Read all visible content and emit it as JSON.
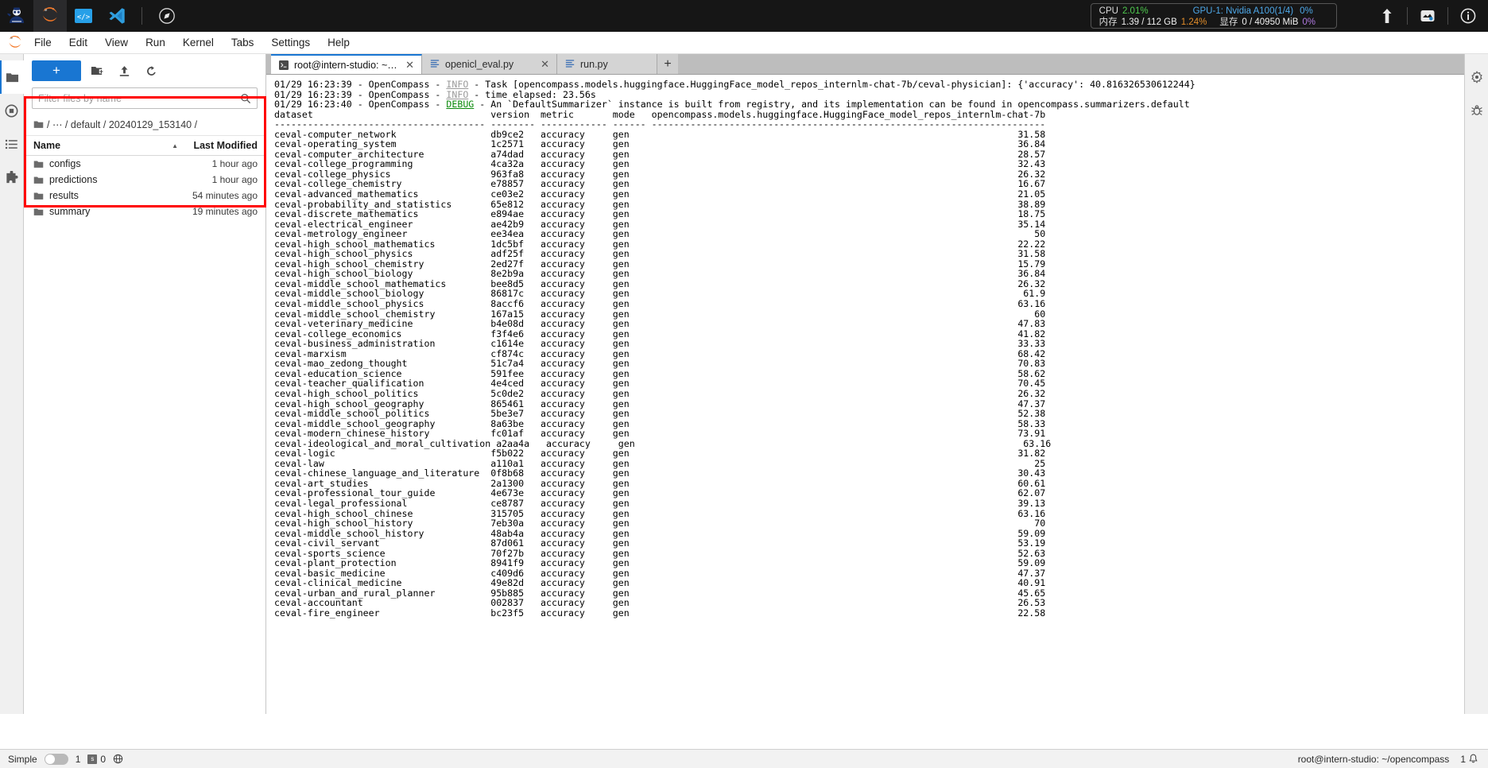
{
  "os_bar": {
    "apps": [
      {
        "name": "intern-studio-logo-icon",
        "active": false
      },
      {
        "name": "jupyterlab-icon",
        "active": true
      },
      {
        "name": "vscode-web-icon",
        "active": false
      },
      {
        "name": "vscode-icon",
        "active": false
      }
    ],
    "compass_icon": "compass-icon",
    "stats": {
      "cpu_label": "CPU",
      "cpu_value": "2.01%",
      "mem_label": "内存",
      "mem_value": "1.39 / 112 GB",
      "mem_percent": "1.24%",
      "gpu_label": "GPU-1: Nvidia A100(1/4)",
      "gpu_percent": "0%",
      "vram_label": "显存",
      "vram_value": "0 / 40950 MiB",
      "vram_percent": "0%"
    },
    "right_icons": [
      "upload-arrow-icon",
      "server-status-icon",
      "info-circle-icon"
    ]
  },
  "menu": {
    "logo_icon": "jupyter-logo-icon",
    "items": [
      "File",
      "Edit",
      "View",
      "Run",
      "Kernel",
      "Tabs",
      "Settings",
      "Help"
    ]
  },
  "left_rail": {
    "items": [
      {
        "name": "file-browser-icon",
        "label": "File Browser",
        "active": true
      },
      {
        "name": "running-terminals-icon",
        "label": "Running Terminals and Kernels",
        "active": false
      },
      {
        "name": "table-of-contents-icon",
        "label": "Table of Contents",
        "active": false
      },
      {
        "name": "extension-manager-icon",
        "label": "Extension Manager",
        "active": false
      }
    ]
  },
  "right_rail": {
    "items": [
      {
        "name": "property-inspector-icon",
        "label": "Property Inspector"
      },
      {
        "name": "debugger-icon",
        "label": "Debugger"
      }
    ]
  },
  "file_browser": {
    "new_launcher_label": "+",
    "toolbar_icons": [
      "new-folder-icon",
      "upload-icon",
      "refresh-icon"
    ],
    "filter_placeholder": "Filter files by name",
    "filter_value": "",
    "search_icon": "search-icon",
    "breadcrumb": {
      "root_icon": "folder-icon",
      "parts": [
        "/",
        "…",
        "/",
        "default",
        "/",
        "20240129_153140",
        "/"
      ],
      "text": "/ ⋯ / default / 20240129_153140 /"
    },
    "columns": {
      "name": "Name",
      "last_modified": "Last Modified"
    },
    "sort_caret": "▲",
    "rows": [
      {
        "name": "configs",
        "modified": "1 hour ago",
        "icon": "folder-icon"
      },
      {
        "name": "predictions",
        "modified": "1 hour ago",
        "icon": "folder-icon"
      },
      {
        "name": "results",
        "modified": "54 minutes ago",
        "icon": "folder-icon"
      },
      {
        "name": "summary",
        "modified": "19 minutes ago",
        "icon": "folder-icon"
      }
    ],
    "highlight_color": "#ff0000"
  },
  "dock": {
    "tabs": [
      {
        "label": "root@intern-studio: ~/ope",
        "icon": "terminal-icon",
        "active": true,
        "closable": true
      },
      {
        "label": "openicl_eval.py",
        "icon": "text-file-icon",
        "active": false,
        "closable": true
      },
      {
        "label": "run.py",
        "icon": "text-file-icon",
        "active": false,
        "closable": true
      }
    ],
    "add_tab_label": "+"
  },
  "terminal": {
    "log_lines": [
      {
        "ts": "01/29 16:23:39",
        "app": "OpenCompass",
        "level": "INFO",
        "level_class": "lg",
        "msg": "Task [opencompass.models.huggingface.HuggingFace_model_repos_internlm-chat-7b/ceval-physician]: {'accuracy': 40.816326530612244}"
      },
      {
        "ts": "01/29 16:23:39",
        "app": "OpenCompass",
        "level": "INFO",
        "level_class": "lg",
        "msg": "time elapsed: 23.56s"
      },
      {
        "ts": "01/29 16:23:40",
        "app": "OpenCompass",
        "level": "DEBUG",
        "level_class": "dg",
        "msg": "An `DefaultSummarizer` instance is built from registry, and its implementation can be found in opencompass.summarizers.default"
      }
    ],
    "table": {
      "headers": [
        "dataset",
        "version",
        "metric",
        "mode",
        "opencompass.models.huggingface.HuggingFace_model_repos_internlm-chat-7b"
      ],
      "rule": "-",
      "rows": [
        {
          "dataset": "ceval-computer_network",
          "version": "db9ce2",
          "metric": "accuracy",
          "mode": "gen",
          "score": "31.58"
        },
        {
          "dataset": "ceval-operating_system",
          "version": "1c2571",
          "metric": "accuracy",
          "mode": "gen",
          "score": "36.84"
        },
        {
          "dataset": "ceval-computer_architecture",
          "version": "a74dad",
          "metric": "accuracy",
          "mode": "gen",
          "score": "28.57"
        },
        {
          "dataset": "ceval-college_programming",
          "version": "4ca32a",
          "metric": "accuracy",
          "mode": "gen",
          "score": "32.43"
        },
        {
          "dataset": "ceval-college_physics",
          "version": "963fa8",
          "metric": "accuracy",
          "mode": "gen",
          "score": "26.32"
        },
        {
          "dataset": "ceval-college_chemistry",
          "version": "e78857",
          "metric": "accuracy",
          "mode": "gen",
          "score": "16.67"
        },
        {
          "dataset": "ceval-advanced_mathematics",
          "version": "ce03e2",
          "metric": "accuracy",
          "mode": "gen",
          "score": "21.05"
        },
        {
          "dataset": "ceval-probability_and_statistics",
          "version": "65e812",
          "metric": "accuracy",
          "mode": "gen",
          "score": "38.89"
        },
        {
          "dataset": "ceval-discrete_mathematics",
          "version": "e894ae",
          "metric": "accuracy",
          "mode": "gen",
          "score": "18.75"
        },
        {
          "dataset": "ceval-electrical_engineer",
          "version": "ae42b9",
          "metric": "accuracy",
          "mode": "gen",
          "score": "35.14"
        },
        {
          "dataset": "ceval-metrology_engineer",
          "version": "ee34ea",
          "metric": "accuracy",
          "mode": "gen",
          "score": "50"
        },
        {
          "dataset": "ceval-high_school_mathematics",
          "version": "1dc5bf",
          "metric": "accuracy",
          "mode": "gen",
          "score": "22.22"
        },
        {
          "dataset": "ceval-high_school_physics",
          "version": "adf25f",
          "metric": "accuracy",
          "mode": "gen",
          "score": "31.58"
        },
        {
          "dataset": "ceval-high_school_chemistry",
          "version": "2ed27f",
          "metric": "accuracy",
          "mode": "gen",
          "score": "15.79"
        },
        {
          "dataset": "ceval-high_school_biology",
          "version": "8e2b9a",
          "metric": "accuracy",
          "mode": "gen",
          "score": "36.84"
        },
        {
          "dataset": "ceval-middle_school_mathematics",
          "version": "bee8d5",
          "metric": "accuracy",
          "mode": "gen",
          "score": "26.32"
        },
        {
          "dataset": "ceval-middle_school_biology",
          "version": "86817c",
          "metric": "accuracy",
          "mode": "gen",
          "score": "61.9"
        },
        {
          "dataset": "ceval-middle_school_physics",
          "version": "8accf6",
          "metric": "accuracy",
          "mode": "gen",
          "score": "63.16"
        },
        {
          "dataset": "ceval-middle_school_chemistry",
          "version": "167a15",
          "metric": "accuracy",
          "mode": "gen",
          "score": "60"
        },
        {
          "dataset": "ceval-veterinary_medicine",
          "version": "b4e08d",
          "metric": "accuracy",
          "mode": "gen",
          "score": "47.83"
        },
        {
          "dataset": "ceval-college_economics",
          "version": "f3f4e6",
          "metric": "accuracy",
          "mode": "gen",
          "score": "41.82"
        },
        {
          "dataset": "ceval-business_administration",
          "version": "c1614e",
          "metric": "accuracy",
          "mode": "gen",
          "score": "33.33"
        },
        {
          "dataset": "ceval-marxism",
          "version": "cf874c",
          "metric": "accuracy",
          "mode": "gen",
          "score": "68.42"
        },
        {
          "dataset": "ceval-mao_zedong_thought",
          "version": "51c7a4",
          "metric": "accuracy",
          "mode": "gen",
          "score": "70.83"
        },
        {
          "dataset": "ceval-education_science",
          "version": "591fee",
          "metric": "accuracy",
          "mode": "gen",
          "score": "58.62"
        },
        {
          "dataset": "ceval-teacher_qualification",
          "version": "4e4ced",
          "metric": "accuracy",
          "mode": "gen",
          "score": "70.45"
        },
        {
          "dataset": "ceval-high_school_politics",
          "version": "5c0de2",
          "metric": "accuracy",
          "mode": "gen",
          "score": "26.32"
        },
        {
          "dataset": "ceval-high_school_geography",
          "version": "865461",
          "metric": "accuracy",
          "mode": "gen",
          "score": "47.37"
        },
        {
          "dataset": "ceval-middle_school_politics",
          "version": "5be3e7",
          "metric": "accuracy",
          "mode": "gen",
          "score": "52.38"
        },
        {
          "dataset": "ceval-middle_school_geography",
          "version": "8a63be",
          "metric": "accuracy",
          "mode": "gen",
          "score": "58.33"
        },
        {
          "dataset": "ceval-modern_chinese_history",
          "version": "fc01af",
          "metric": "accuracy",
          "mode": "gen",
          "score": "73.91"
        },
        {
          "dataset": "ceval-ideological_and_moral_cultivation",
          "version": "a2aa4a",
          "metric": "accuracy",
          "mode": "gen",
          "score": "63.16"
        },
        {
          "dataset": "ceval-logic",
          "version": "f5b022",
          "metric": "accuracy",
          "mode": "gen",
          "score": "31.82"
        },
        {
          "dataset": "ceval-law",
          "version": "a110a1",
          "metric": "accuracy",
          "mode": "gen",
          "score": "25"
        },
        {
          "dataset": "ceval-chinese_language_and_literature",
          "version": "0f8b68",
          "metric": "accuracy",
          "mode": "gen",
          "score": "30.43"
        },
        {
          "dataset": "ceval-art_studies",
          "version": "2a1300",
          "metric": "accuracy",
          "mode": "gen",
          "score": "60.61"
        },
        {
          "dataset": "ceval-professional_tour_guide",
          "version": "4e673e",
          "metric": "accuracy",
          "mode": "gen",
          "score": "62.07"
        },
        {
          "dataset": "ceval-legal_professional",
          "version": "ce8787",
          "metric": "accuracy",
          "mode": "gen",
          "score": "39.13"
        },
        {
          "dataset": "ceval-high_school_chinese",
          "version": "315705",
          "metric": "accuracy",
          "mode": "gen",
          "score": "63.16"
        },
        {
          "dataset": "ceval-high_school_history",
          "version": "7eb30a",
          "metric": "accuracy",
          "mode": "gen",
          "score": "70"
        },
        {
          "dataset": "ceval-middle_school_history",
          "version": "48ab4a",
          "metric": "accuracy",
          "mode": "gen",
          "score": "59.09"
        },
        {
          "dataset": "ceval-civil_servant",
          "version": "87d061",
          "metric": "accuracy",
          "mode": "gen",
          "score": "53.19"
        },
        {
          "dataset": "ceval-sports_science",
          "version": "70f27b",
          "metric": "accuracy",
          "mode": "gen",
          "score": "52.63"
        },
        {
          "dataset": "ceval-plant_protection",
          "version": "8941f9",
          "metric": "accuracy",
          "mode": "gen",
          "score": "59.09"
        },
        {
          "dataset": "ceval-basic_medicine",
          "version": "c409d6",
          "metric": "accuracy",
          "mode": "gen",
          "score": "47.37"
        },
        {
          "dataset": "ceval-clinical_medicine",
          "version": "49e82d",
          "metric": "accuracy",
          "mode": "gen",
          "score": "40.91"
        },
        {
          "dataset": "ceval-urban_and_rural_planner",
          "version": "95b885",
          "metric": "accuracy",
          "mode": "gen",
          "score": "45.65"
        },
        {
          "dataset": "ceval-accountant",
          "version": "002837",
          "metric": "accuracy",
          "mode": "gen",
          "score": "26.53"
        },
        {
          "dataset": "ceval-fire_engineer",
          "version": "bc23f5",
          "metric": "accuracy",
          "mode": "gen",
          "score": "22.58"
        }
      ]
    }
  },
  "status_bar": {
    "mode_label": "Simple",
    "toggle_state": "off",
    "terminal_count": "1",
    "kernel_count": "0",
    "kernel_icon": "kernel-square-icon",
    "globe_icon": "globe-icon",
    "path": "root@intern-studio: ~/opencompass",
    "notification_count": "1",
    "notification_icon": "bell-icon"
  }
}
